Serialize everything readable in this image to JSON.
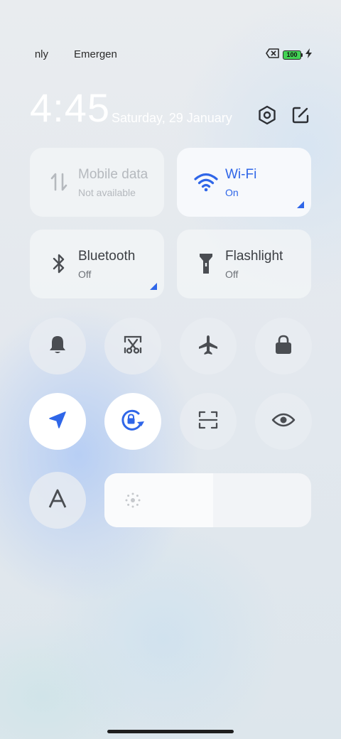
{
  "status_bar": {
    "carrier_1": "nly",
    "carrier_2": "Emergen",
    "battery_level": "100",
    "icons": [
      "sim-missing-icon",
      "battery-icon",
      "charging-icon"
    ]
  },
  "header": {
    "time": "4:45",
    "date": "Saturday, 29 January",
    "settings_icon": "settings-hex-icon",
    "edit_icon": "edit-icon"
  },
  "tiles": {
    "mobile_data": {
      "title": "Mobile data",
      "subtitle": "Not available",
      "state": "disabled"
    },
    "wifi": {
      "title": "Wi-Fi",
      "subtitle": "On",
      "state": "on"
    },
    "bluetooth": {
      "title": "Bluetooth",
      "subtitle": "Off",
      "state": "off"
    },
    "flashlight": {
      "title": "Flashlight",
      "subtitle": "Off",
      "state": "off"
    }
  },
  "toggles": [
    {
      "name": "ringer",
      "icon": "bell-icon",
      "on": false
    },
    {
      "name": "screenshot",
      "icon": "scissors-icon",
      "on": false
    },
    {
      "name": "airplane-mode",
      "icon": "airplane-icon",
      "on": false
    },
    {
      "name": "lock-screen",
      "icon": "lock-icon",
      "on": false
    },
    {
      "name": "location",
      "icon": "location-arrow-icon",
      "on": true
    },
    {
      "name": "rotation-lock",
      "icon": "rotation-lock-icon",
      "on": true
    },
    {
      "name": "scanner",
      "icon": "scan-icon",
      "on": false
    },
    {
      "name": "reading-mode",
      "icon": "eye-icon",
      "on": false
    },
    {
      "name": "font-size",
      "icon": "letter-a-icon",
      "on": false
    }
  ],
  "brightness": {
    "level": 0.525
  },
  "colors": {
    "accent": "#2f66e8",
    "icon_dark": "#4a4d52"
  }
}
